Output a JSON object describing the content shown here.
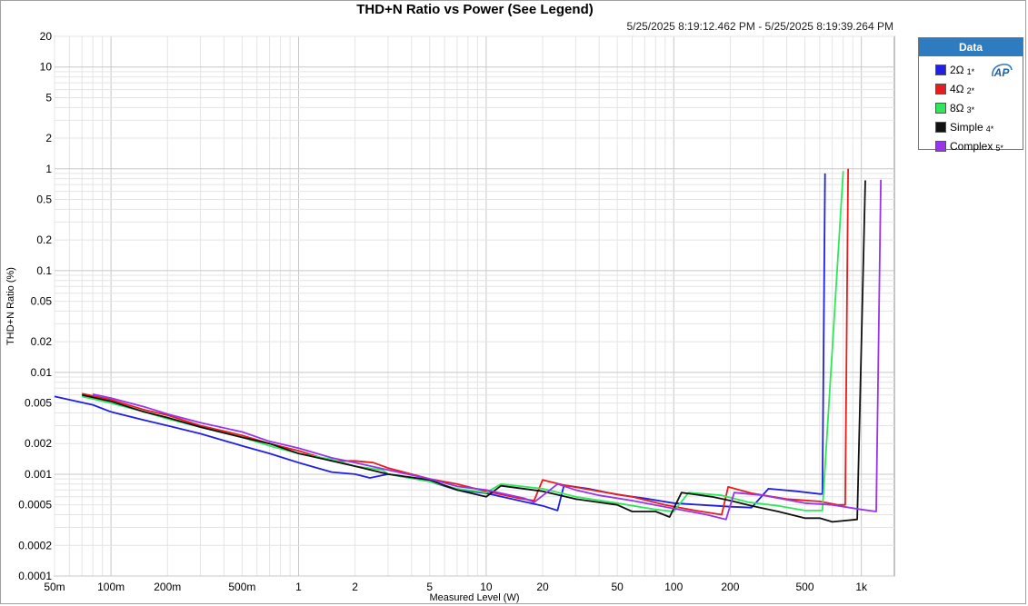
{
  "window": {
    "title": "THD+N Ratio vs Power (See Legend)",
    "timestamp": "5/25/2025 8:19:12.462 PM - 5/25/2025 8:19:39.264 PM"
  },
  "legend": {
    "header": "Data",
    "logo_text": "AP",
    "items": [
      {
        "label": "2Ω",
        "index": "1*",
        "color": "#1f1fe6"
      },
      {
        "label": "4Ω",
        "index": "2*",
        "color": "#e81c1c"
      },
      {
        "label": "8Ω",
        "index": "3*",
        "color": "#2ee85a"
      },
      {
        "label": "Simple",
        "index": "4*",
        "color": "#111111"
      },
      {
        "label": "Complex",
        "index": "5*",
        "color": "#9933ee"
      }
    ]
  },
  "chart_data": {
    "type": "line",
    "title": "THD+N Ratio vs Power (See Legend)",
    "xlabel": "Measured Level (W)",
    "ylabel": "THD+N Ratio (%)",
    "xscale": "log",
    "yscale": "log",
    "xlim": [
      0.05,
      1500
    ],
    "ylim": [
      0.0001,
      20
    ],
    "grid": true,
    "legend_position": "right",
    "x_ticks": [
      {
        "v": 0.05,
        "label": "50m"
      },
      {
        "v": 0.1,
        "label": "100m"
      },
      {
        "v": 0.2,
        "label": "200m"
      },
      {
        "v": 0.5,
        "label": "500m"
      },
      {
        "v": 1,
        "label": "1"
      },
      {
        "v": 2,
        "label": "2"
      },
      {
        "v": 5,
        "label": "5"
      },
      {
        "v": 10,
        "label": "10"
      },
      {
        "v": 20,
        "label": "20"
      },
      {
        "v": 50,
        "label": "50"
      },
      {
        "v": 100,
        "label": "100"
      },
      {
        "v": 200,
        "label": "200"
      },
      {
        "v": 500,
        "label": "500"
      },
      {
        "v": 1000,
        "label": "1k"
      }
    ],
    "y_ticks": [
      {
        "v": 20,
        "label": "20"
      },
      {
        "v": 10,
        "label": "10"
      },
      {
        "v": 5,
        "label": "5"
      },
      {
        "v": 2,
        "label": "2"
      },
      {
        "v": 1,
        "label": "1"
      },
      {
        "v": 0.5,
        "label": "0.5"
      },
      {
        "v": 0.2,
        "label": "0.2"
      },
      {
        "v": 0.1,
        "label": "0.1"
      },
      {
        "v": 0.05,
        "label": "0.05"
      },
      {
        "v": 0.02,
        "label": "0.02"
      },
      {
        "v": 0.01,
        "label": "0.01"
      },
      {
        "v": 0.005,
        "label": "0.005"
      },
      {
        "v": 0.002,
        "label": "0.002"
      },
      {
        "v": 0.001,
        "label": "0.001"
      },
      {
        "v": 0.0005,
        "label": "0.0005"
      },
      {
        "v": 0.0002,
        "label": "0.0002"
      },
      {
        "v": 0.0001,
        "label": "0.0001"
      }
    ],
    "series": [
      {
        "name": "2Ω",
        "color": "#1f1fe6",
        "x": [
          0.05,
          0.08,
          0.1,
          0.15,
          0.2,
          0.3,
          0.5,
          0.7,
          1,
          1.5,
          2,
          2.4,
          3,
          5,
          7,
          10,
          15,
          20,
          24,
          26,
          35,
          50,
          70,
          100,
          140,
          200,
          260,
          320,
          450,
          600,
          620,
          640
        ],
        "y": [
          0.0058,
          0.0048,
          0.0041,
          0.0034,
          0.003,
          0.0025,
          0.0019,
          0.0016,
          0.0013,
          0.00105,
          0.001,
          0.00092,
          0.001,
          0.00085,
          0.0007,
          0.00065,
          0.00055,
          0.00049,
          0.00044,
          0.00078,
          0.00072,
          0.00063,
          0.00058,
          0.00052,
          0.0005,
          0.00048,
          0.00047,
          0.00072,
          0.00068,
          0.00064,
          0.00064,
          0.9
        ]
      },
      {
        "name": "4Ω",
        "color": "#e81c1c",
        "x": [
          0.07,
          0.1,
          0.15,
          0.2,
          0.3,
          0.5,
          0.7,
          1,
          1.5,
          2,
          2.5,
          3,
          5,
          7,
          10,
          15,
          18,
          20,
          26,
          40,
          60,
          90,
          130,
          180,
          195,
          260,
          400,
          600,
          750,
          820,
          850
        ],
        "y": [
          0.0062,
          0.0054,
          0.0043,
          0.0038,
          0.003,
          0.0024,
          0.002,
          0.0017,
          0.00135,
          0.00135,
          0.0013,
          0.00115,
          0.0009,
          0.0008,
          0.00068,
          0.00058,
          0.00055,
          0.00088,
          0.00078,
          0.00068,
          0.0006,
          0.0005,
          0.00044,
          0.0004,
          0.00075,
          0.00065,
          0.00057,
          0.00054,
          0.0005,
          0.0005,
          1.0
        ]
      },
      {
        "name": "8Ω",
        "color": "#2ee85a",
        "x": [
          0.07,
          0.1,
          0.15,
          0.2,
          0.3,
          0.5,
          0.7,
          1,
          1.5,
          2,
          2.8,
          3,
          5,
          7,
          10,
          12,
          20,
          30,
          50,
          80,
          100,
          120,
          180,
          250,
          360,
          500,
          560,
          620,
          800
        ],
        "y": [
          0.0058,
          0.005,
          0.0041,
          0.0035,
          0.0029,
          0.0023,
          0.0019,
          0.0016,
          0.0014,
          0.0012,
          0.0011,
          0.001,
          0.00085,
          0.00072,
          0.00066,
          0.0008,
          0.00072,
          0.0006,
          0.00052,
          0.00045,
          0.00043,
          0.00066,
          0.00062,
          0.00053,
          0.00049,
          0.00044,
          0.00044,
          0.00044,
          0.95
        ]
      },
      {
        "name": "Simple",
        "color": "#111111",
        "x": [
          0.07,
          0.1,
          0.15,
          0.2,
          0.3,
          0.5,
          0.7,
          1,
          1.5,
          2,
          3,
          5,
          7,
          10,
          12,
          20,
          30,
          50,
          60,
          80,
          95,
          110,
          160,
          200,
          260,
          360,
          500,
          600,
          700,
          950,
          1050
        ],
        "y": [
          0.006,
          0.0052,
          0.0041,
          0.0036,
          0.0029,
          0.0023,
          0.002,
          0.0016,
          0.00135,
          0.0012,
          0.001,
          0.00088,
          0.0007,
          0.0006,
          0.00077,
          0.00068,
          0.00057,
          0.0005,
          0.00043,
          0.00043,
          0.00038,
          0.00066,
          0.0006,
          0.00055,
          0.00049,
          0.00043,
          0.00037,
          0.00037,
          0.00034,
          0.00036,
          0.77
        ]
      },
      {
        "name": "Complex",
        "color": "#9933ee",
        "x": [
          0.08,
          0.1,
          0.15,
          0.2,
          0.3,
          0.5,
          0.7,
          1,
          1.5,
          2,
          3,
          5,
          7,
          10,
          16,
          18,
          24,
          30,
          40,
          60,
          100,
          150,
          190,
          210,
          300,
          500,
          700,
          1000,
          1200,
          1270
        ],
        "y": [
          0.0061,
          0.0056,
          0.0046,
          0.0039,
          0.0032,
          0.0026,
          0.0021,
          0.0018,
          0.00145,
          0.0013,
          0.0011,
          0.0009,
          0.00076,
          0.0007,
          0.00058,
          0.00053,
          0.0008,
          0.0007,
          0.00062,
          0.00055,
          0.00046,
          0.0004,
          0.00036,
          0.00066,
          0.00062,
          0.00052,
          0.0005,
          0.00045,
          0.00043,
          0.78
        ]
      }
    ]
  }
}
